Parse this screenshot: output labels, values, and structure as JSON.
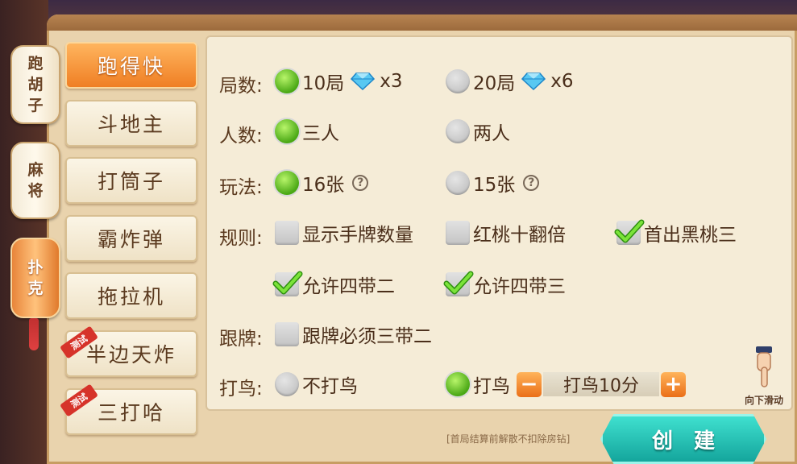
{
  "side_tabs": [
    {
      "label_chars": [
        "跑",
        "胡",
        "子"
      ],
      "active": false
    },
    {
      "label_chars": [
        "麻",
        "将"
      ],
      "active": false
    },
    {
      "label_chars": [
        "扑",
        "克"
      ],
      "active": true
    }
  ],
  "games": [
    {
      "label": "跑得快",
      "active": true,
      "badge": ""
    },
    {
      "label": "斗地主",
      "active": false,
      "badge": ""
    },
    {
      "label": "打筒子",
      "active": false,
      "badge": ""
    },
    {
      "label": "霸炸弹",
      "active": false,
      "badge": ""
    },
    {
      "label": "拖拉机",
      "active": false,
      "badge": ""
    },
    {
      "label": "半边天炸",
      "active": false,
      "badge": "测试"
    },
    {
      "label": "三打哈",
      "active": false,
      "badge": "测试"
    }
  ],
  "rows": {
    "rounds": {
      "label": "局数:",
      "options": [
        {
          "text": "10局",
          "cost": "x3",
          "selected": true
        },
        {
          "text": "20局",
          "cost": "x6",
          "selected": false
        }
      ]
    },
    "players": {
      "label": "人数:",
      "options": [
        {
          "text": "三人",
          "selected": true
        },
        {
          "text": "两人",
          "selected": false
        }
      ]
    },
    "mode": {
      "label": "玩法:",
      "options": [
        {
          "text": "16张",
          "selected": true
        },
        {
          "text": "15张",
          "selected": false
        }
      ],
      "help_glyph": "?"
    },
    "rules": {
      "label": "规则:",
      "options": [
        {
          "text": "显示手牌数量",
          "checked": false
        },
        {
          "text": "红桃十翻倍",
          "checked": false
        },
        {
          "text": "首出黑桃三",
          "checked": true
        },
        {
          "text": "允许四带二",
          "checked": true
        },
        {
          "text": "允许四带三",
          "checked": true
        }
      ]
    },
    "follow": {
      "label": "跟牌:",
      "options": [
        {
          "text": "跟牌必须三带二",
          "checked": false
        }
      ]
    },
    "bird": {
      "label": "打鸟:",
      "options": [
        {
          "text": "不打鸟",
          "selected": false
        },
        {
          "text": "打鸟",
          "selected": true
        }
      ],
      "stepper_value": "打鸟10分",
      "minus": "−",
      "plus": "+"
    }
  },
  "footer": {
    "hint": "[首局结算前解散不扣除房钻]",
    "create_label": "创建",
    "scroll_hint": "向下滑动"
  },
  "colors": {
    "accent_orange": "#ef7f24",
    "selected_green": "#4aa815",
    "create_teal": "#14a59c"
  }
}
